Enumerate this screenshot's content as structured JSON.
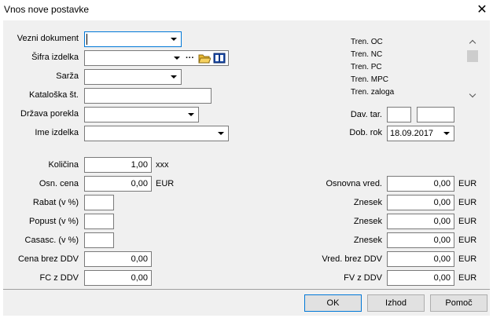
{
  "window": {
    "title": "Vnos nove postavke"
  },
  "labels": {
    "vezni_dokument": "Vezni dokument",
    "sifra_izdelka": "Šifra izdelka",
    "sarza": "Sarža",
    "kataloska": "Kataloška št.",
    "drzava": "Država porekla",
    "ime_izdelka": "Ime izdelka",
    "kolicina": "Količina",
    "osn_cena": "Osn. cena",
    "rabat": "Rabat (v %)",
    "popust": "Popust (v %)",
    "casasc": "Casasc. (v %)",
    "cena_brez_ddv": "Cena brez DDV",
    "fc_z_ddv": "FC z DDV",
    "dav_tar": "Dav. tar.",
    "dob_rok": "Dob. rok",
    "osnovna_vred": "Osnovna vred.",
    "znesek": "Znesek",
    "vred_brez_ddv": "Vred. brez DDV",
    "fv_z_ddv": "FV z DDV"
  },
  "values": {
    "vezni_dokument": "",
    "sifra_izdelka": "",
    "sarza": "",
    "kataloska": "",
    "drzava": "",
    "ime_izdelka": "",
    "kolicina": "1,00",
    "kolicina_unit": "xxx",
    "osn_cena": "0,00",
    "osn_cena_unit": "EUR",
    "rabat": "",
    "popust": "",
    "casasc": "",
    "cena_brez_ddv": "0,00",
    "fc_z_ddv": "0,00",
    "dav_tar_1": "",
    "dav_tar_2": "",
    "dob_rok": "18.09.2017",
    "osnovna_vred": "0,00",
    "znesek_1": "0,00",
    "znesek_2": "0,00",
    "znesek_3": "0,00",
    "vred_brez_ddv": "0,00",
    "fv_z_ddv": "0,00",
    "currency": "EUR",
    "ellipsis": "···"
  },
  "stock_list": [
    "Tren. OC",
    "Tren. NC",
    "Tren. PC",
    "Tren. MPC",
    "Tren. zaloga"
  ],
  "buttons": {
    "ok": "OK",
    "izhod": "Izhod",
    "pomoc": "Pomoč"
  },
  "icons": {
    "folder": "folder-open-icon",
    "book": "catalog-book-icon",
    "close": "close-icon"
  },
  "colors": {
    "focus": "#0078d7",
    "panel": "#f0f0f0",
    "border": "#7a7a7a"
  }
}
